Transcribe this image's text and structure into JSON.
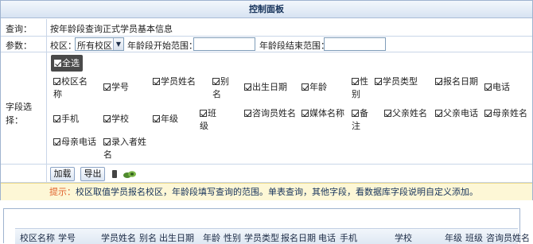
{
  "panel": {
    "title": "控制面板"
  },
  "query": {
    "label": "查询：",
    "value": "按年龄段查询正式学员基本信息"
  },
  "params": {
    "label": "参数：",
    "campus_label": "校区：",
    "campus_selected": "所有校区",
    "age_start_label": "年龄段开始范围：",
    "age_start_value": "",
    "age_end_label": "年龄段结束范围：",
    "age_end_value": ""
  },
  "fields": {
    "label": "字段选择：",
    "select_all": "全选",
    "items": [
      {
        "label": "校区名称",
        "checked": true
      },
      {
        "label": "学号",
        "checked": true
      },
      {
        "label": "学员姓名",
        "checked": true
      },
      {
        "label": "别名",
        "checked": true
      },
      {
        "label": "出生日期",
        "checked": true
      },
      {
        "label": "年龄",
        "checked": true
      },
      {
        "label": "性别",
        "checked": true
      },
      {
        "label": "学员类型",
        "checked": true
      },
      {
        "label": "报名日期",
        "checked": true
      },
      {
        "label": "电话",
        "checked": true
      },
      {
        "label": "手机",
        "checked": true
      },
      {
        "label": "学校",
        "checked": true
      },
      {
        "label": "年级",
        "checked": true
      },
      {
        "label": "班级",
        "checked": true
      },
      {
        "label": "咨询员姓名",
        "checked": true
      },
      {
        "label": "媒体名称",
        "checked": true
      },
      {
        "label": "备注",
        "checked": true
      },
      {
        "label": "父亲姓名",
        "checked": true
      },
      {
        "label": "父亲电话",
        "checked": true
      },
      {
        "label": "母亲姓名",
        "checked": true
      },
      {
        "label": "母亲电话",
        "checked": true
      },
      {
        "label": "录入者姓名",
        "checked": true
      }
    ]
  },
  "actions": {
    "load_label": "加载",
    "export_label": "导出",
    "icons": [
      "excel-icon",
      "export-icon"
    ]
  },
  "hint": {
    "label": "提示：",
    "text": "校区取值学员报名校区，年龄段填写查询的范围。单表查询，其他字段，看数据库字段说明自定义添加。"
  },
  "table": {
    "columns": [
      "校区名称",
      "学号",
      "学员姓名",
      "别名",
      "出生日期",
      "年龄",
      "性别",
      "学员类型",
      "报名日期",
      "电话",
      "手机",
      "学校",
      "年级",
      "班级",
      "咨询员姓名"
    ]
  },
  "colors": {
    "header_text": "#15325a",
    "hint_label": "#e0622d",
    "hint_bg": "#fdf7d6",
    "border": "#9fb3cf"
  }
}
